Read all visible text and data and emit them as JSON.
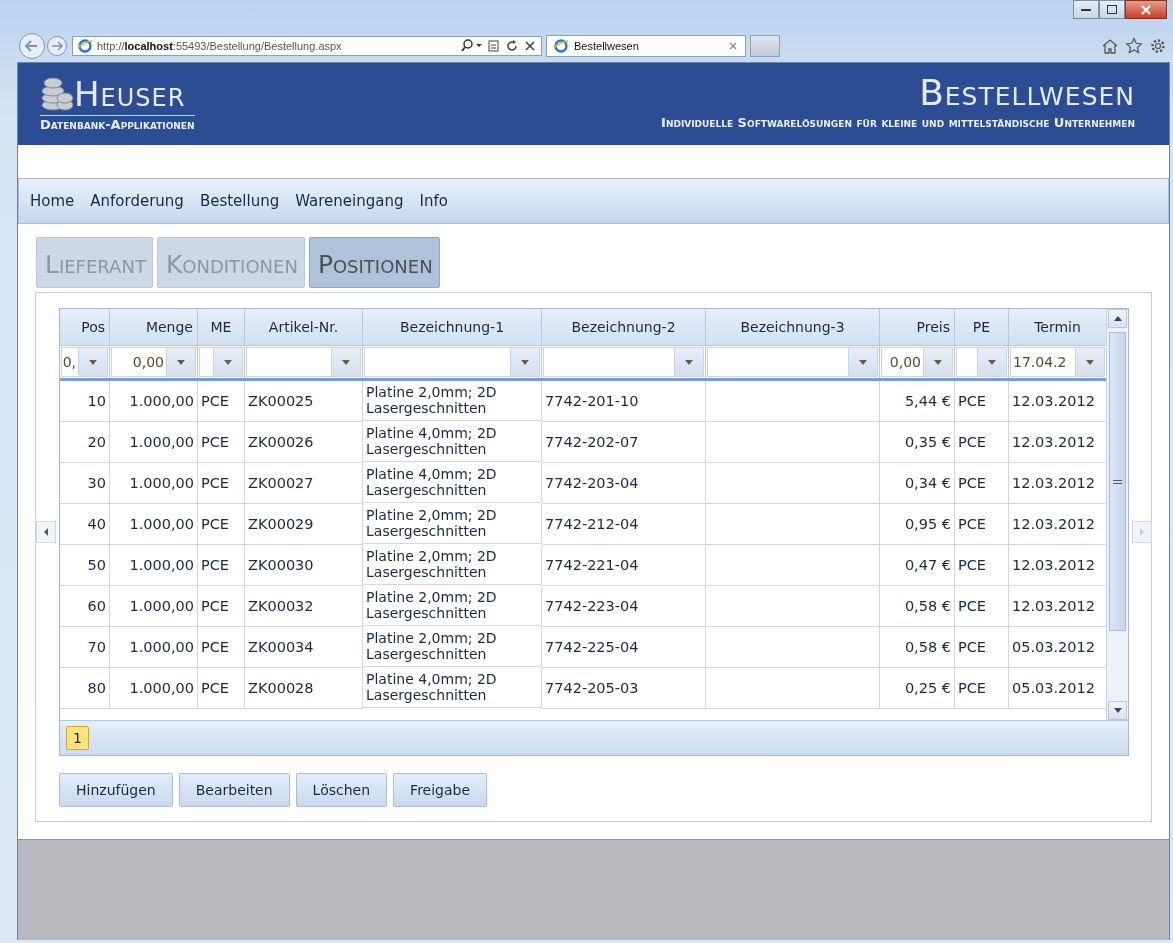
{
  "browser": {
    "address": "http://**localhost**:55493/Bestellung/Bestellung.aspx",
    "tab_title": "Bestellwesen"
  },
  "header": {
    "logo_title": "Heuser",
    "logo_subtitle": "Datenbank-Applikationen",
    "app_title": "Bestellwesen",
    "tagline": "Individuelle Softwarelösungen für kleine und mittelständische Unternehmen"
  },
  "menu": [
    "Home",
    "Anforderung",
    "Bestellung",
    "Wareneingang",
    "Info"
  ],
  "tabs": [
    {
      "label": "Lieferant",
      "selected": false
    },
    {
      "label": "Konditionen",
      "selected": false
    },
    {
      "label": "Positionen",
      "selected": true
    }
  ],
  "grid": {
    "columns": [
      {
        "label": "Pos",
        "filter": "0,"
      },
      {
        "label": "Menge",
        "filter": "0,00"
      },
      {
        "label": "ME"
      },
      {
        "label": "Artikel-Nr."
      },
      {
        "label": "Bezeichnung-1"
      },
      {
        "label": "Bezeichnung-2"
      },
      {
        "label": "Bezeichnung-3"
      },
      {
        "label": "Preis",
        "filter": "0,00"
      },
      {
        "label": "PE"
      },
      {
        "label": "Termin",
        "filter": "17.04.2"
      }
    ],
    "rows": [
      {
        "cells": [
          "10",
          "1.000,00",
          "PCE",
          "ZK00025",
          "Platine 2,0mm; 2D Lasergeschnitten",
          "7742-201-10",
          null,
          "5,44 €",
          "PCE",
          "12.03.2012"
        ]
      },
      {
        "cells": [
          "20",
          "1.000,00",
          "PCE",
          "ZK00026",
          "Platine 4,0mm; 2D Lasergeschnitten",
          "7742-202-07",
          null,
          "0,35 €",
          "PCE",
          "12.03.2012"
        ]
      },
      {
        "cells": [
          "30",
          "1.000,00",
          "PCE",
          "ZK00027",
          "Platine 4,0mm; 2D Lasergeschnitten",
          "7742-203-04",
          null,
          "0,34 €",
          "PCE",
          "12.03.2012"
        ]
      },
      {
        "cells": [
          "40",
          "1.000,00",
          "PCE",
          "ZK00029",
          "Platine 2,0mm; 2D Lasergeschnitten",
          "7742-212-04",
          null,
          "0,95 €",
          "PCE",
          "12.03.2012"
        ]
      },
      {
        "cells": [
          "50",
          "1.000,00",
          "PCE",
          "ZK00030",
          "Platine 2,0mm; 2D Lasergeschnitten",
          "7742-221-04",
          null,
          "0,47 €",
          "PCE",
          "12.03.2012"
        ]
      },
      {
        "cells": [
          "60",
          "1.000,00",
          "PCE",
          "ZK00032",
          "Platine 2,0mm; 2D Lasergeschnitten",
          "7742-223-04",
          null,
          "0,58 €",
          "PCE",
          "12.03.2012"
        ]
      },
      {
        "cells": [
          "70",
          "1.000,00",
          "PCE",
          "ZK00034",
          "Platine 2,0mm; 2D Lasergeschnitten",
          "7742-225-04",
          null,
          "0,58 €",
          "PCE",
          "05.03.2012"
        ]
      },
      {
        "cells": [
          "80",
          "1.000,00",
          "PCE",
          "ZK00028",
          "Platine 4,0mm; 2D Lasergeschnitten",
          "7742-205-03",
          null,
          "0,25 €",
          "PCE",
          "05.03.2012"
        ]
      }
    ],
    "pager": [
      {
        "label": "1",
        "selected": true
      }
    ]
  },
  "buttons": [
    "Hinzufügen",
    "Bearbeiten",
    "Löschen",
    "Freigabe"
  ]
}
